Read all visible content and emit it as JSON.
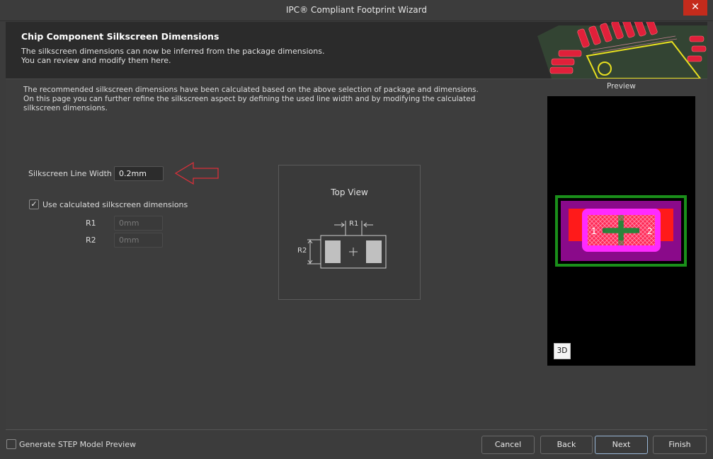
{
  "window": {
    "title": "IPC® Compliant Footprint Wizard",
    "close_glyph": "✕"
  },
  "header": {
    "title": "Chip Component Silkscreen Dimensions",
    "subtitle_line1": "The silkscreen dimensions can now be inferred from the package dimensions.",
    "subtitle_line2": "You can review and modify them here."
  },
  "intro": {
    "line1": "The recommended silkscreen dimensions have been calculated based on the above selection of package and dimensions.",
    "line2": "On this page you can further refine the silkscreen aspect by defining the used line width and by modifying the calculated",
    "line3": "silkscreen dimensions."
  },
  "form": {
    "line_width_label": "Silkscreen Line Width",
    "line_width_value": "0.2mm",
    "use_calculated_label": "Use calculated silkscreen dimensions",
    "use_calculated_checked": true,
    "check_glyph": "✓",
    "r1_label": "R1",
    "r1_value": "0mm",
    "r2_label": "R2",
    "r2_value": "0mm"
  },
  "top_view": {
    "title": "Top View",
    "r1_label": "R1",
    "r2_label": "R2"
  },
  "preview": {
    "label": "Preview",
    "btn_3d": "3D"
  },
  "footer": {
    "generate_step_label": "Generate STEP Model Preview",
    "generate_step_checked": false,
    "cancel": "Cancel",
    "back": "Back",
    "next": "Next",
    "finish": "Finish"
  }
}
